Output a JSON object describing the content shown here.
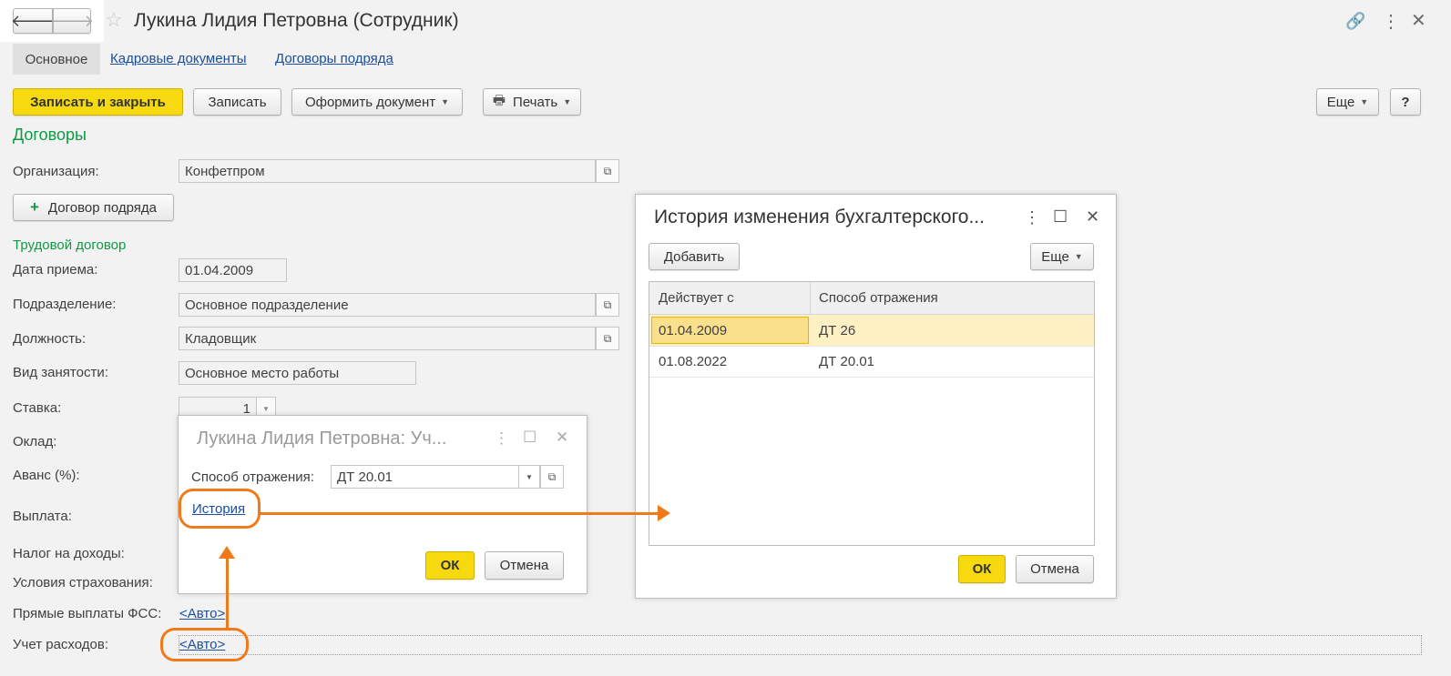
{
  "window": {
    "title": "Лукина Лидия Петровна (Сотрудник)",
    "nav_back": "🡐",
    "nav_forward": "🡒"
  },
  "tabs": {
    "main": "Основное",
    "hr_docs": "Кадровые документы",
    "contracts": "Договоры подряда"
  },
  "toolbar": {
    "save_close": "Записать и закрыть",
    "save": "Записать",
    "make_doc": "Оформить документ",
    "print": "Печать",
    "more": "Еще",
    "help": "?"
  },
  "section": {
    "contracts_title": "Договоры",
    "org_label": "Организация:",
    "org_value": "Конфетпром",
    "add_contract": "Договор подряда",
    "employment_title": "Трудовой договор",
    "hire_date_label": "Дата приема:",
    "hire_date_value": "01.04.2009",
    "dept_label": "Подразделение:",
    "dept_value": "Основное подразделение",
    "position_label": "Должность:",
    "position_value": "Кладовщик",
    "employment_type_label": "Вид занятости:",
    "employment_type_value": "Основное место работы",
    "rate_label": "Ставка:",
    "rate_value": "1",
    "salary_label": "Оклад:",
    "advance_label": "Аванс (%):",
    "payment_label": "Выплата:",
    "tax_label": "Налог на доходы:",
    "insurance_label": "Условия страхования:",
    "fss_label": "Прямые выплаты ФСС:",
    "fss_value": "<Авто>",
    "expense_label": "Учет расходов:",
    "expense_value": "<Авто>"
  },
  "small_dialog": {
    "title": "Лукина Лидия Петровна: Уч...",
    "method_label": "Способ отражения:",
    "method_value": "ДТ 20.01",
    "history_link": "История",
    "ok": "ОК",
    "cancel": "Отмена"
  },
  "history_dialog": {
    "title": "История изменения бухгалтерского...",
    "add": "Добавить",
    "more": "Еще",
    "columns": [
      "Действует с",
      "Способ отражения"
    ],
    "rows": [
      {
        "date": "01.04.2009",
        "method": "ДТ 26"
      },
      {
        "date": "01.08.2022",
        "method": "ДТ 20.01"
      }
    ],
    "ok": "ОК",
    "cancel": "Отмена"
  },
  "colors": {
    "accent_yellow": "#f6d90f",
    "green_title": "#119a44",
    "link_blue": "#1a4fa0",
    "highlight_orange": "#f07a1a",
    "selected_row": "#fdf0c2"
  }
}
